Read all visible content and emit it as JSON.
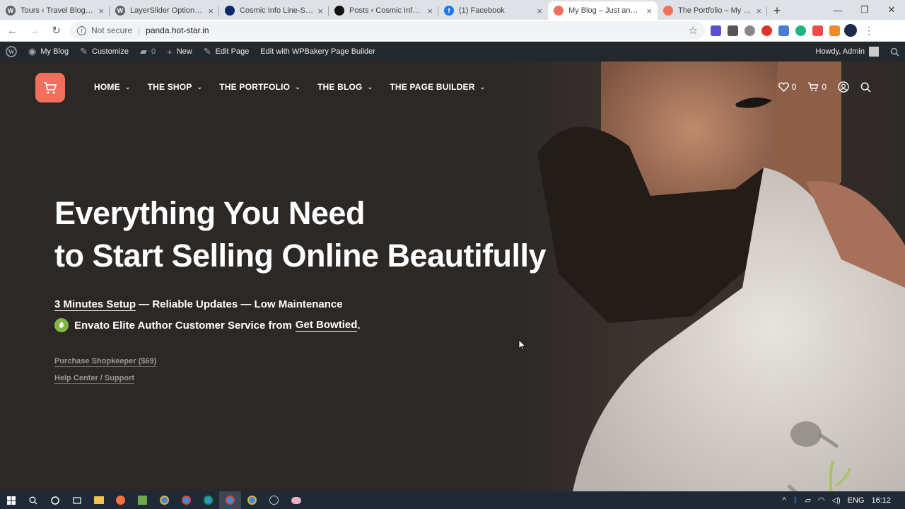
{
  "browser": {
    "tabs": [
      {
        "title": "Tours ‹ Travel Blog — W",
        "color": "#5f6368",
        "glyph": "W"
      },
      {
        "title": "LayerSlider Options ‹ Tr",
        "color": "#5f6368",
        "glyph": "W"
      },
      {
        "title": "Cosmic Info Line-Step",
        "color": "#0b2a6b",
        "glyph": ""
      },
      {
        "title": "Posts ‹ Cosmic Info Lin",
        "color": "#111111",
        "glyph": ""
      },
      {
        "title": "(1) Facebook",
        "color": "#1877f2",
        "glyph": "f"
      },
      {
        "title": "My Blog – Just anothe",
        "color": "#f26f5b",
        "glyph": ""
      },
      {
        "title": "The Portfolio – My Blog",
        "color": "#f26f5b",
        "glyph": ""
      }
    ],
    "active_tab": 5,
    "security_label": "Not secure",
    "url": "panda.hot-star.in"
  },
  "wp_admin": {
    "site_name": "My Blog",
    "customize": "Customize",
    "comments_count": "0",
    "new_label": "New",
    "edit_page": "Edit Page",
    "edit_wpbakery": "Edit with WPBakery Page Builder",
    "howdy": "Howdy, Admin"
  },
  "nav": {
    "items": [
      "HOME",
      "THE SHOP",
      "THE PORTFOLIO",
      "THE BLOG",
      "THE PAGE BUILDER"
    ],
    "wishlist_count": "0",
    "cart_count": "0",
    "accent": "#f26f5b"
  },
  "hero": {
    "headline_line1": "Everything You Need",
    "headline_line2": "to Start Selling Online Beautifully",
    "features_link": "3 Minutes Setup",
    "features_rest": " — Reliable Updates — Low Maintenance",
    "support_text": "Envato Elite Author Customer Service from",
    "support_link": "Get Bowtied",
    "support_end": ".",
    "purchase_link": "Purchase Shopkeeper ($69)",
    "help_link": "Help Center / Support"
  },
  "taskbar": {
    "lang": "ENG",
    "time": "16:12"
  }
}
